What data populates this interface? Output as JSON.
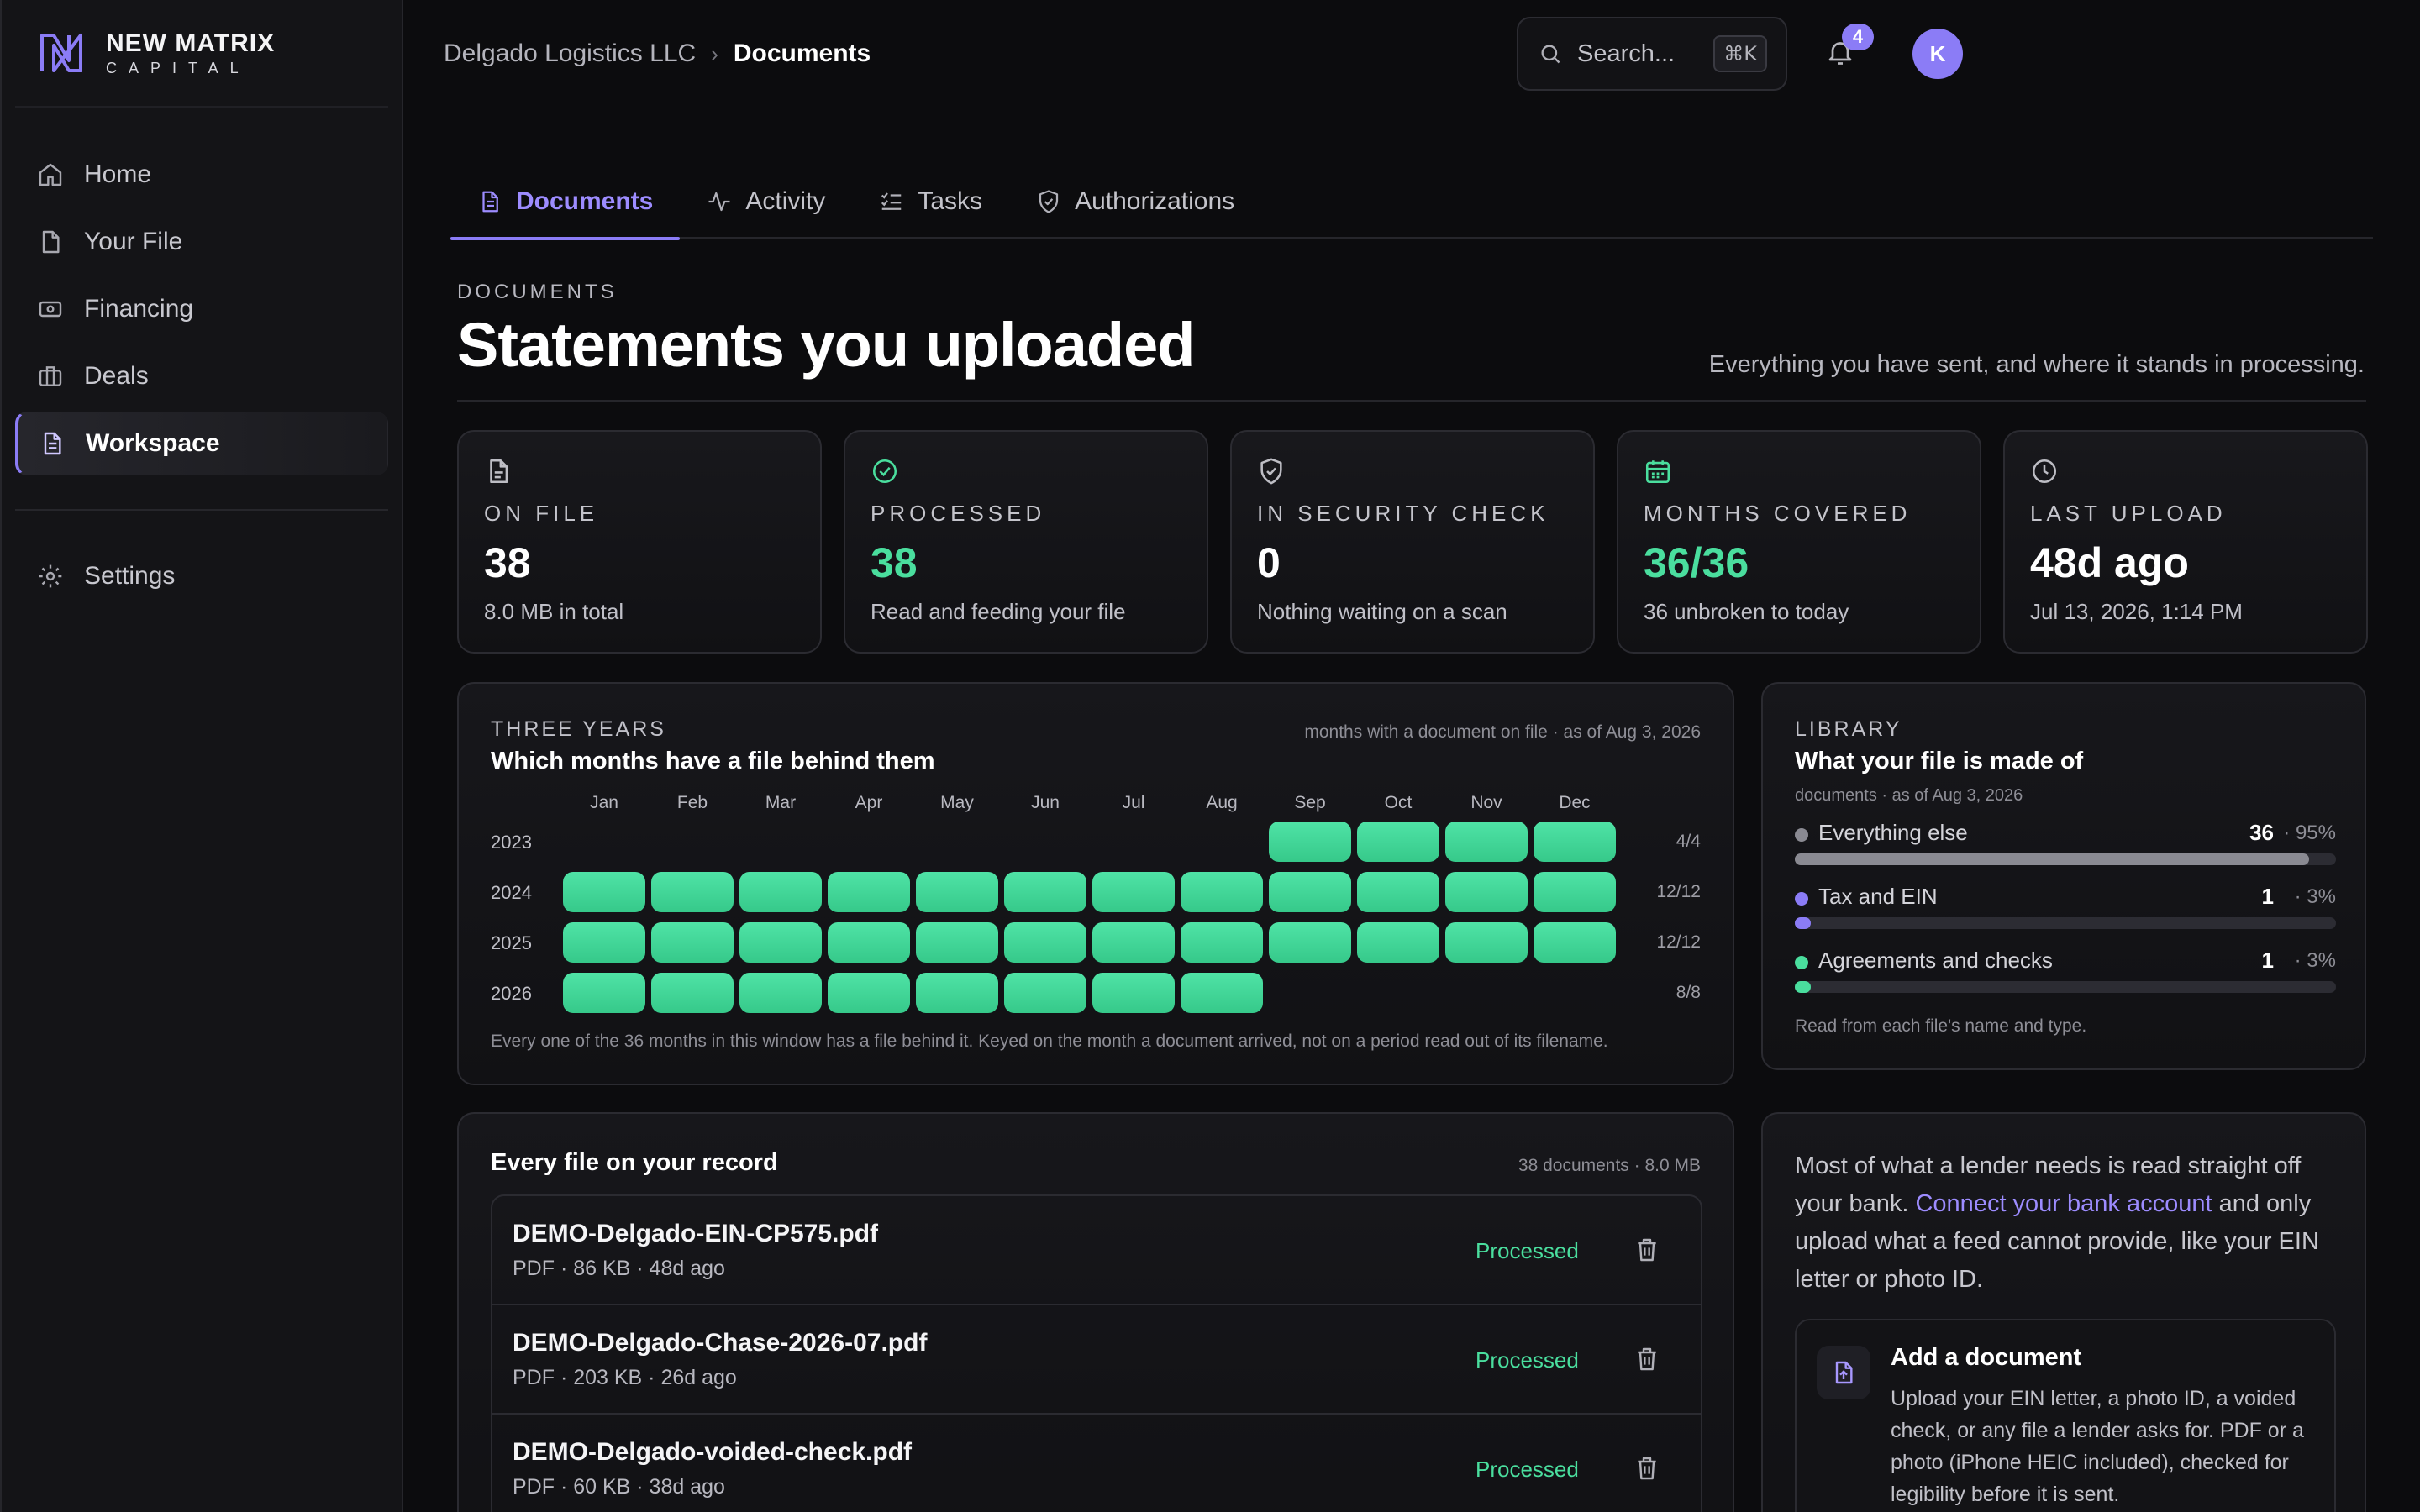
{
  "brand": {
    "name": "NEW MATRIX",
    "sub": "CAPITAL"
  },
  "nav": {
    "items": [
      {
        "label": "Home",
        "icon": "home-icon"
      },
      {
        "label": "Your File",
        "icon": "file-icon"
      },
      {
        "label": "Financing",
        "icon": "banknote-icon"
      },
      {
        "label": "Deals",
        "icon": "briefcase-icon"
      },
      {
        "label": "Workspace",
        "icon": "document-icon",
        "active": true
      }
    ],
    "settings": "Settings"
  },
  "breadcrumb": {
    "org": "Delgado Logistics LLC",
    "sep": "›",
    "current": "Documents"
  },
  "search": {
    "placeholder": "Search...",
    "shortcut": "⌘K"
  },
  "notifications": {
    "count": "4"
  },
  "user": {
    "initial": "K"
  },
  "tabs": [
    {
      "label": "Documents",
      "active": true
    },
    {
      "label": "Activity"
    },
    {
      "label": "Tasks"
    },
    {
      "label": "Authorizations"
    }
  ],
  "header": {
    "eyebrow": "DOCUMENTS",
    "title": "Statements you uploaded",
    "description": "Everything you have sent, and where it stands in processing."
  },
  "stats": [
    {
      "label": "ON FILE",
      "value": "38",
      "sub": "8.0 MB in total",
      "accent": false
    },
    {
      "label": "PROCESSED",
      "value": "38",
      "sub": "Read and feeding your file",
      "accent": true
    },
    {
      "label": "IN SECURITY CHECK",
      "value": "0",
      "sub": "Nothing waiting on a scan",
      "accent": false
    },
    {
      "label": "MONTHS COVERED",
      "value": "36/36",
      "sub": "36 unbroken to today",
      "accent": true
    },
    {
      "label": "LAST UPLOAD",
      "value": "48d ago",
      "sub": "Jul 13, 2026, 1:14 PM",
      "accent": false
    }
  ],
  "coverage": {
    "eyebrow": "THREE YEARS",
    "title": "Which months have a file behind them",
    "meta": "months with a document on file · as of Aug 3, 2026",
    "months": [
      "Jan",
      "Feb",
      "Mar",
      "Apr",
      "May",
      "Jun",
      "Jul",
      "Aug",
      "Sep",
      "Oct",
      "Nov",
      "Dec"
    ],
    "years": [
      {
        "year": "2023",
        "filled": [
          8,
          9,
          10,
          11
        ],
        "count": "4/4"
      },
      {
        "year": "2024",
        "filled": [
          0,
          1,
          2,
          3,
          4,
          5,
          6,
          7,
          8,
          9,
          10,
          11
        ],
        "count": "12/12"
      },
      {
        "year": "2025",
        "filled": [
          0,
          1,
          2,
          3,
          4,
          5,
          6,
          7,
          8,
          9,
          10,
          11
        ],
        "count": "12/12"
      },
      {
        "year": "2026",
        "filled": [
          0,
          1,
          2,
          3,
          4,
          5,
          6,
          7
        ],
        "count": "8/8"
      }
    ],
    "footnote": "Every one of the 36 months in this window has a file behind it. Keyed on the month a document arrived, not on a period read out of its filename."
  },
  "library": {
    "eyebrow": "LIBRARY",
    "title": "What your file is made of",
    "meta": "documents · as of Aug 3, 2026",
    "rows": [
      {
        "name": "Everything else",
        "count": "36",
        "pct": "· 95%",
        "fraction": 0.95,
        "color": "#8a8a92"
      },
      {
        "name": "Tax and EIN",
        "count": "1",
        "pct": "· 3%",
        "fraction": 0.03,
        "color": "#8b7cf6"
      },
      {
        "name": "Agreements and checks",
        "count": "1",
        "pct": "· 3%",
        "fraction": 0.03,
        "color": "#4ade9e"
      }
    ],
    "footnote": "Read from each file's name and type."
  },
  "files": {
    "title": "Every file on your record",
    "meta": "38 documents · 8.0 MB",
    "rows": [
      {
        "name": "DEMO-Delgado-EIN-CP575.pdf",
        "meta": "PDF · 86 KB · 48d ago",
        "status": "Processed"
      },
      {
        "name": "DEMO-Delgado-Chase-2026-07.pdf",
        "meta": "PDF · 203 KB · 26d ago",
        "status": "Processed"
      },
      {
        "name": "DEMO-Delgado-voided-check.pdf",
        "meta": "PDF · 60 KB · 38d ago",
        "status": "Processed"
      }
    ]
  },
  "upload": {
    "intro_before": "Most of what a lender needs is read straight off your bank. ",
    "intro_link": "Connect your bank account",
    "intro_after": " and only upload what a feed cannot provide, like your EIN letter or photo ID.",
    "card_title": "Add a document",
    "card_desc": "Upload your EIN letter, a photo ID, a voided check, or any file a lender asks for. PDF or a photo (iPhone HEIC included), checked for legibility before it is sent."
  },
  "colors": {
    "accent": "#8b7cf6",
    "success": "#4ade9e",
    "background": "#0c0c0e"
  }
}
